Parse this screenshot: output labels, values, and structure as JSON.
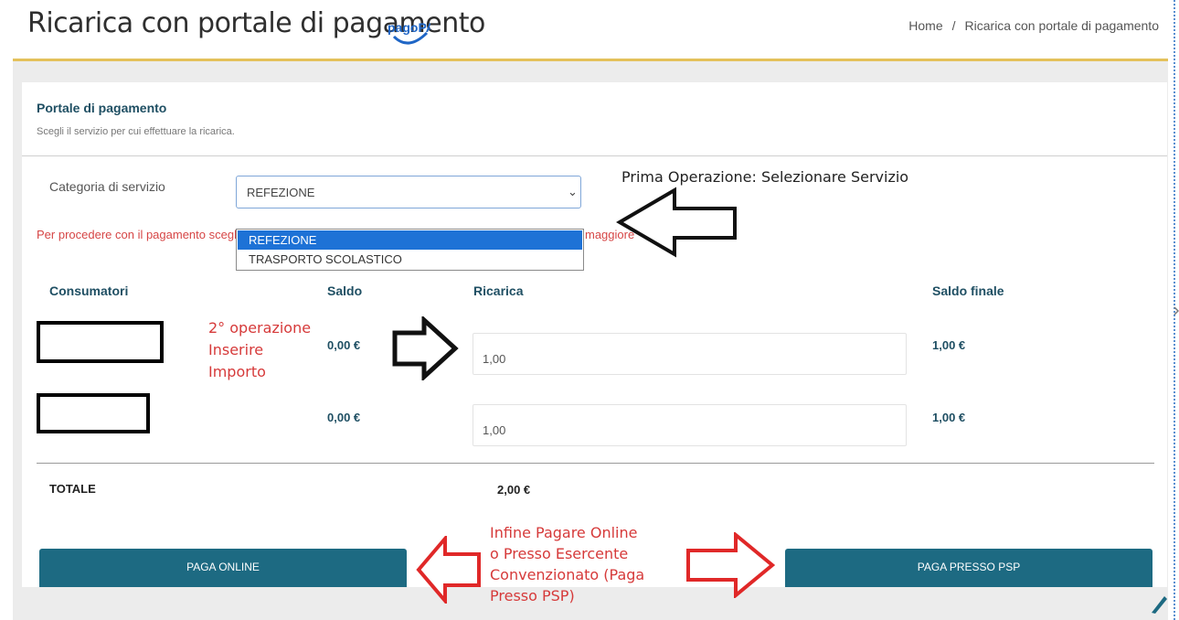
{
  "header": {
    "title": "Ricarica con portale di pagamento",
    "logo_text": "pagoPA",
    "breadcrumb": [
      "Home",
      "Ricarica con portale di pagamento"
    ],
    "breadcrumb_separator": "/"
  },
  "panel": {
    "title": "Portale di pagamento",
    "subtitle": "Scegli il servizio per cui effettuare la ricarica."
  },
  "service_category": {
    "label": "Categoria di servizio",
    "selected": "REFEZIONE",
    "options": [
      "REFEZIONE",
      "TRASPORTO SCOLASTICO"
    ]
  },
  "warning_text": {
    "left": "Per procedere con il pagamento scegli",
    "right": "maggiore"
  },
  "table": {
    "headers": {
      "consumers": "Consumatori",
      "balance": "Saldo",
      "recharge": "Ricarica",
      "final_balance": "Saldo finale"
    },
    "rows": [
      {
        "balance": "0,00 €",
        "recharge": "1,00",
        "final_balance": "1,00 €"
      },
      {
        "balance": "0,00 €",
        "recharge": "1,00",
        "final_balance": "1,00 €"
      }
    ],
    "total_label": "TOTALE",
    "total_value": "2,00 €"
  },
  "buttons": {
    "pay_online": "PAGA ONLINE",
    "pay_psp": "PAGA PRESSO PSP"
  },
  "annotations": {
    "step1": "Prima Operazione: Selezionare Servizio",
    "step2": [
      "2° operazione",
      "Inserire",
      "Importo"
    ],
    "step3": [
      "Infine Pagare Online",
      "o Presso Esercente",
      "Convenzionato (Paga",
      "Presso PSP)"
    ]
  },
  "colors": {
    "accent_gold": "#e4c15b",
    "heading_teal": "#1f4f63",
    "button_teal": "#1d6a82",
    "selection_blue": "#1e72d6",
    "annotation_red": "#d63a3a"
  },
  "icons": [
    "pagopa-logo",
    "chevron-down-icon",
    "arrow-left-annotation",
    "arrow-right-annotation",
    "pencil-icon"
  ]
}
